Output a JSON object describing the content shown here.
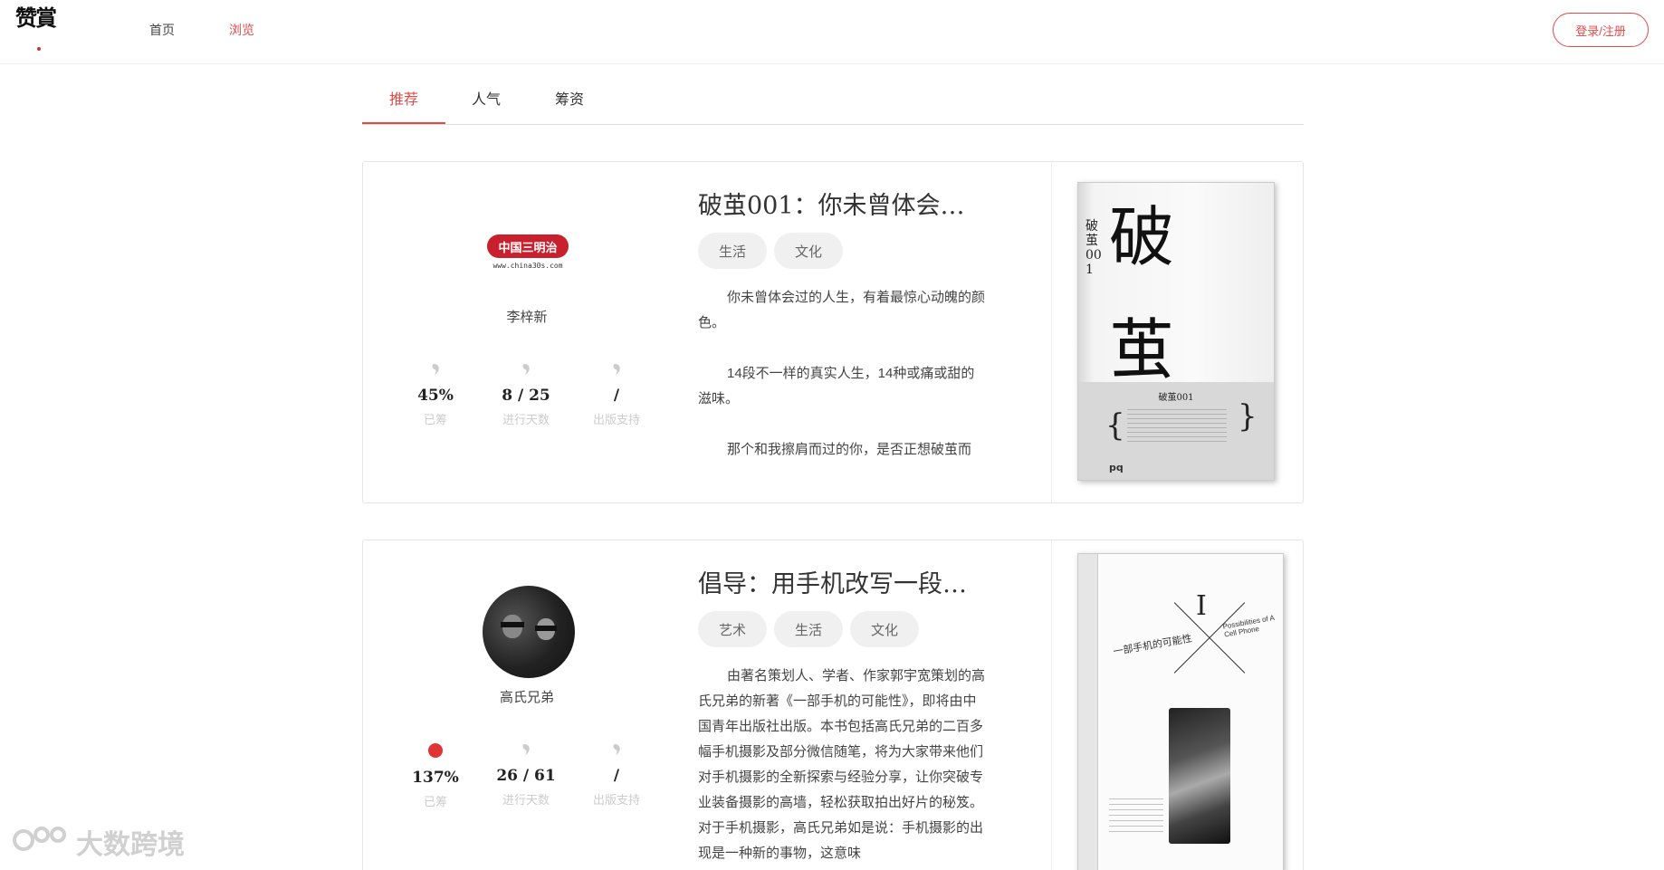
{
  "header": {
    "logo_text": "赞賞",
    "nav": {
      "home": "首页",
      "browse": "浏览"
    },
    "login_label": "登录/注册",
    "accent_color": "#e04b4b"
  },
  "tabs": [
    {
      "label": "推荐",
      "active": true
    },
    {
      "label": "人气",
      "active": false
    },
    {
      "label": "筹资",
      "active": false
    }
  ],
  "projects": [
    {
      "title": "破茧001：你未曾体会…",
      "author": {
        "name": "李梓新",
        "logo_text": "中国三明治",
        "logo_url": "www.china30s.com"
      },
      "stats": {
        "percent": "45%",
        "percent_label": "已筹",
        "days": "8 / 25",
        "days_label": "进行天数",
        "support": "/",
        "support_label": "出版支持"
      },
      "tags": [
        "生活",
        "文化"
      ],
      "description": [
        "你未曾体会过的人生，有着最惊心动魄的颜色。",
        "14段不一样的真实人生，14种或痛或甜的滋味。",
        "那个和我擦肩而过的你，是否正想破茧而"
      ],
      "cover": {
        "big_char_1": "破",
        "big_char_2": "茧",
        "side_text": "破茧001",
        "band_text": "破茧001",
        "publisher_mark": "pq"
      }
    },
    {
      "title": "倡导：用手机改写一段…",
      "author": {
        "name": "高氏兄弟"
      },
      "stats": {
        "percent": "137%",
        "percent_label": "已筹",
        "days": "26 / 61",
        "days_label": "进行天数",
        "support": "/",
        "support_label": "出版支持"
      },
      "tags": [
        "艺术",
        "生活",
        "文化"
      ],
      "description": "由著名策划人、学者、作家郭宇宽策划的高氏兄弟的新著《一部手机的可能性》，即将由中国青年出版社出版。本书包括高氏兄弟的二百多幅手机摄影及部分微信随笔，将为大家带来他们对手机摄影的全新探索与经验分享，让你突破专业装备摄影的高墙，轻松获取拍出好片的秘笈。对于手机摄影，高氏兄弟如是说：手机摄影的出现是一种新的事物，这意味",
      "cover": {
        "big_char": "I",
        "title_cn": "一部手机的可能性",
        "title_en": "Possibilities of A Cell Phone"
      }
    }
  ],
  "watermark": "大数跨境"
}
